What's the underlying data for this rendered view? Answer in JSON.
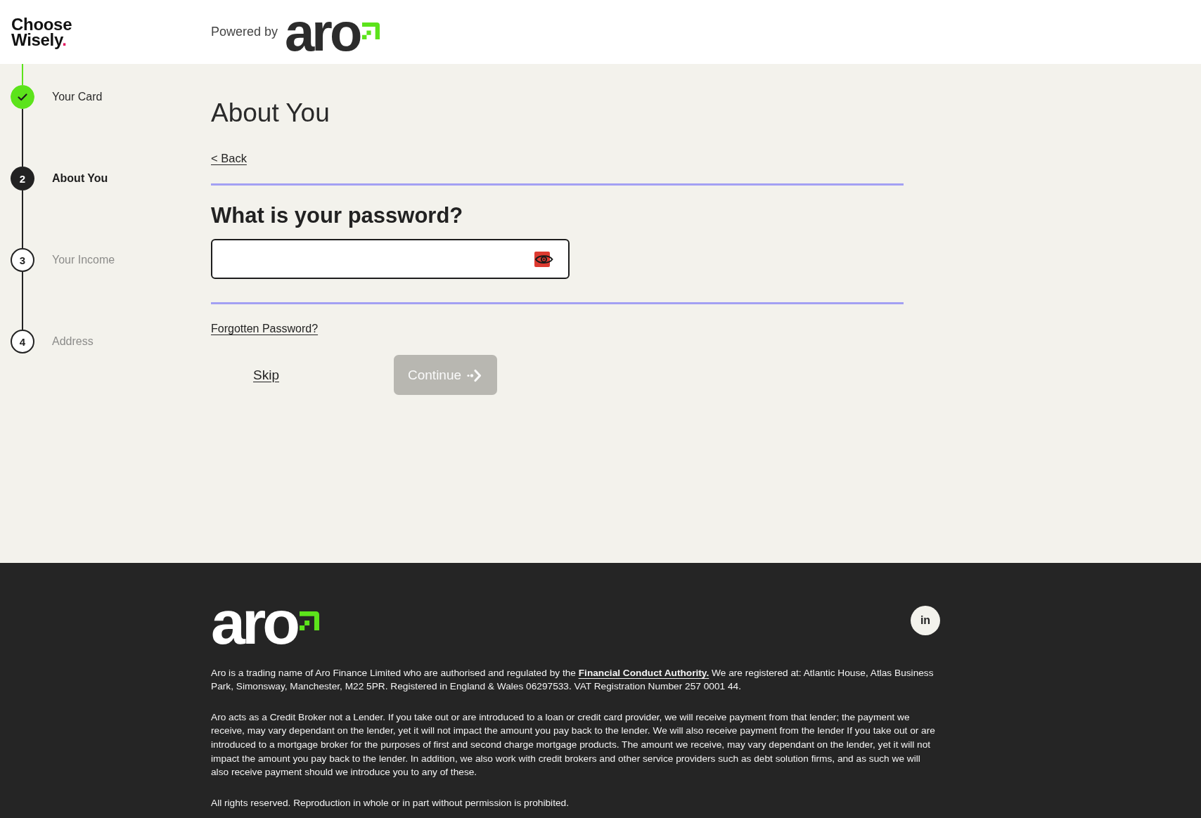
{
  "header": {
    "brand": {
      "text": "Choose Wisely",
      "mark": "."
    },
    "powered_by": "Powered by",
    "partner_logo": "aro"
  },
  "steps": [
    {
      "label": "Your Card",
      "completed": true,
      "selected": false
    },
    {
      "number": "2",
      "label": "About You",
      "completed": false,
      "selected": true
    },
    {
      "number": "3",
      "label": "Your Income",
      "completed": false,
      "selected": false
    },
    {
      "number": "4",
      "label": "Address",
      "completed": false,
      "selected": false
    }
  ],
  "form": {
    "title": "About You",
    "back_link": "< Back",
    "question": "What is your password?",
    "forgot_link": "Forgotten Password?",
    "skip": "Skip",
    "continue": {
      "label": "Continue",
      "disabled": true
    }
  },
  "footer": {
    "logo": "aro",
    "social": [
      {
        "label": "in"
      }
    ],
    "registration": {
      "before": "Aro is a trading name of Aro Finance Limited who are authorised and regulated by the ",
      "link": "Financial Conduct Authority.",
      "after": " We are registered at: Atlantic House, Atlas Business Park, Simonsway, Manchester, M22 5PR. Registered in England & Wales 06297533. VAT Registration Number 257 0001 44."
    },
    "broker_notice": "Aro acts as a Credit Broker not a Lender. If you take out or are introduced to a loan or credit card provider, we will receive payment from that lender; the payment we receive, may vary dependant on the lender, yet it will not impact the amount you pay back to the lender. We will also receive payment from the lender If you take out or are introduced to a mortgage broker for the purposes of first and second charge mortgage products. The amount we receive, may vary dependant on the lender, yet it will not impact the amount you pay back to the lender. In addition, we also work with credit brokers and other service providers such as debt solution firms, and as such we will also receive payment should we introduce you to any of these.",
    "rights": "All rights reserved. Reproduction in whole or in part without permission is prohibited."
  }
}
